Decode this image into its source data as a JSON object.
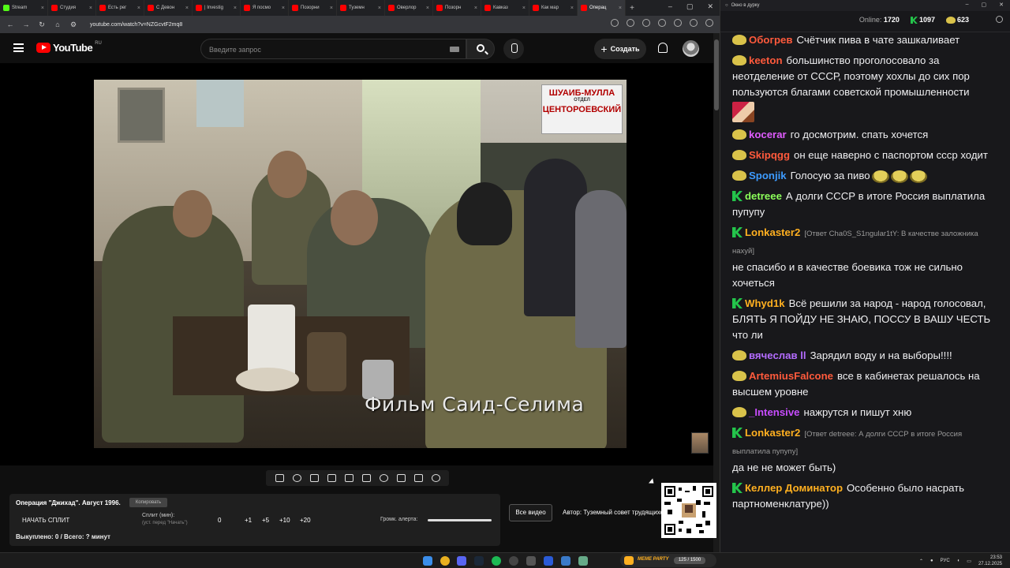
{
  "browser": {
    "tabs": [
      {
        "label": "Stream",
        "color": "#53fc18"
      },
      {
        "label": "Студия",
        "color": "#ff0000"
      },
      {
        "label": "Есть рег",
        "color": "#ff0000"
      },
      {
        "label": "С Девон",
        "color": "#ff0000"
      },
      {
        "label": "| Investig",
        "color": "#ff0000"
      },
      {
        "label": "Я посмо",
        "color": "#ff0000"
      },
      {
        "label": "Позорни",
        "color": "#ff0000"
      },
      {
        "label": "Туземн",
        "color": "#ff0000"
      },
      {
        "label": "Оверлор",
        "color": "#ff0000"
      },
      {
        "label": "Позорн",
        "color": "#ff0000"
      },
      {
        "label": "Кавказ",
        "color": "#ff0000"
      },
      {
        "label": "Как мар",
        "color": "#ff0000"
      },
      {
        "label": "Операц",
        "color": "#ff0000",
        "active": true
      }
    ],
    "url": "youtube.com/watch?v=NZGcvtF2mq8"
  },
  "youtube": {
    "logo_text": "YouTube",
    "country": "RU",
    "search_placeholder": "Введите запрос",
    "create_label": "Создать"
  },
  "video": {
    "caption": "Фильм Саид-Селима",
    "sign_line1": "ШУАИБ-МУЛЛА",
    "sign_line2": "ОТДЕЛ",
    "sign_line3": "ЦЕНТОРОЕВСКИЙ"
  },
  "split_panel": {
    "title": "Операция \"Джихад\". Август 1996.",
    "copy_label": "Копировать",
    "start_label": "НАЧАТЬ СПЛИТ",
    "split_label": "Сплит (мин):",
    "split_hint": "(уст. перед \"Начать\")",
    "split_value": "0",
    "increments": [
      "+1",
      "+5",
      "+10",
      "+20"
    ],
    "alert_label": "Громк. алерта:",
    "progress": "Выкуплено: 0 / Всего: ? минут"
  },
  "all_videos_label": "Все видео",
  "author_label": "Автор: Туземный совет трудящихся",
  "chat": {
    "window_title": "Окно в дурку",
    "online_label": "Online:",
    "online_value": "1720",
    "k_value": "1097",
    "pepe_value": "623",
    "messages": [
      {
        "badge": "pepe",
        "user": "Обогрев",
        "color": "#ff5a3c",
        "text": "Счётчик пива в чате зашкаливает"
      },
      {
        "badge": "pepe",
        "user": "keeton",
        "color": "#ff5a3c",
        "text": "большинство проголосовало за неотделение от СССР, поэтому хохлы до сих пор пользуются благами советской промышленности",
        "image": true
      },
      {
        "badge": "pepe",
        "user": "kocerar",
        "color": "#e05cff",
        "text": "го досмотрим. спать хочется"
      },
      {
        "badge": "pepe",
        "user": "Skipqgg",
        "color": "#ff5a3c",
        "text": "он еще наверно с паспортом ссср ходит"
      },
      {
        "badge": "pepe",
        "user": "Sponjik",
        "color": "#3d9bff",
        "text": "Голосую за пиво",
        "emotes": 3
      },
      {
        "badge": "k",
        "user": "detreee",
        "color": "#8cff5a",
        "text": "А долги СССР в итоге Россия выплатила пупупу"
      },
      {
        "badge": "k",
        "user": "Lonkaster2",
        "color": "#ffb020",
        "reply": "[Ответ Cha0S_S1ngular1tY: В качестве заложника нахуй]",
        "text": "не спасибо и в качестве боевика тож не сильно хочеться"
      },
      {
        "badge": "k",
        "user": "Whyd1k",
        "color": "#ffb020",
        "text": "Всё решили за народ - народ голосовал, БЛЯТЬ Я ПОЙДУ НЕ ЗНАЮ, ПОССУ В ВАШУ ЧЕСТЬ что ли"
      },
      {
        "badge": "pepe",
        "user": "вячеслав ll",
        "color": "#b46cff",
        "text": "Зарядил воду и на выборы!!!!"
      },
      {
        "badge": "pepe",
        "user": "ArtemiusFalcone",
        "color": "#ff5a3c",
        "text": "все в кабинетах решалось на высшем уровне"
      },
      {
        "badge": "pepe",
        "user": "_Intensive",
        "color": "#c84cff",
        "text": "нажрутся и пишут хню"
      },
      {
        "badge": "k",
        "user": "Lonkaster2",
        "color": "#ffb020",
        "reply": "[Ответ detreee: А долги СССР в итоге Россия выплатила пупупу]",
        "text": "да не не может быть)"
      },
      {
        "badge": "k",
        "user": "Келлер Доминатор",
        "color": "#ffb020",
        "text": "Особенно было насрать партноменклатуре))"
      }
    ]
  },
  "taskbar": {
    "meme_title": "MEME PARTY",
    "meme_count": "125 / 1500",
    "lang": "РУС",
    "time": "23:53",
    "date": "27.12.2025"
  }
}
